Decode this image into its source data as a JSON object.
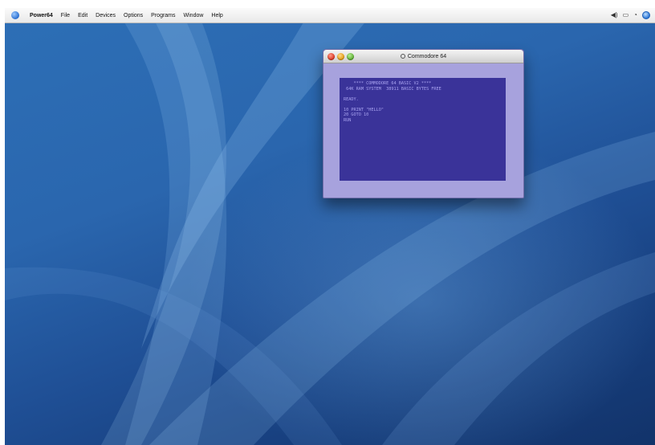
{
  "menubar": {
    "apple_menu": "apple-icon",
    "items": [
      "Power64",
      "File",
      "Edit",
      "Devices",
      "Options",
      "Programs",
      "Window",
      "Help"
    ],
    "status_icons": [
      "volume-icon",
      "battery-icon",
      "clock-icon",
      "spotlight-icon"
    ]
  },
  "window": {
    "title": "Commodore 64",
    "screen_bg": "#3a3399",
    "screen_fg": "#a9a3f0",
    "screen_lines": [
      "    **** COMMODORE 64 BASIC V2 ****",
      " 64K RAM SYSTEM  38911 BASIC BYTES FREE",
      "",
      "READY.",
      "",
      "10 PRINT \"HELLO\"",
      "20 GOTO 10",
      "RUN",
      ""
    ]
  },
  "colors": {
    "desktop_top": "#2d6fb6",
    "desktop_bottom": "#12336a",
    "window_border": "#a7a2dd"
  }
}
